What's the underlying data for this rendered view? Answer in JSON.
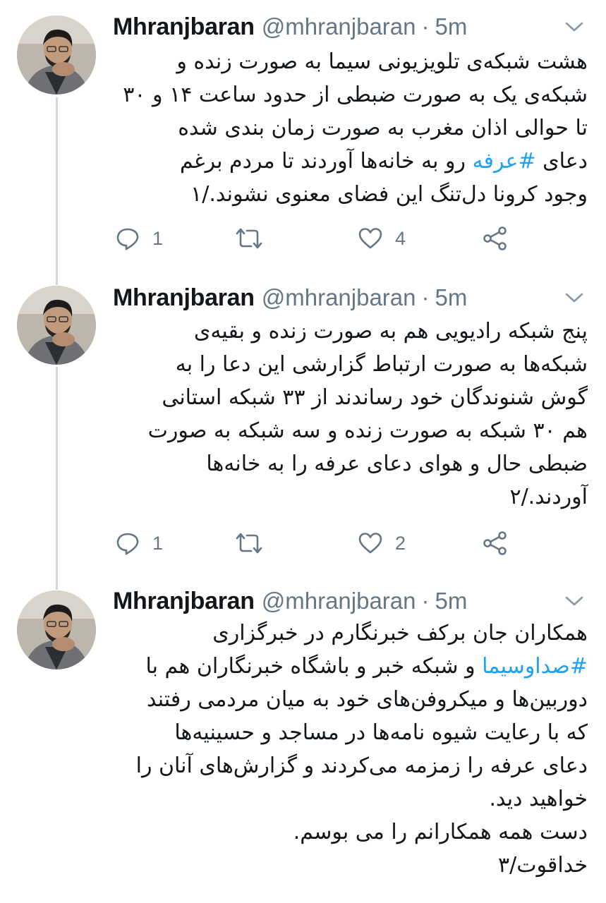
{
  "tweets": [
    {
      "name": "Mhranjbaran",
      "handle": "@mhranjbaran",
      "dot": "·",
      "time": "5m",
      "lines": [
        {
          "text": "هشت شبکه‌ی تلویزیونی سیما به صورت زنده و"
        },
        {
          "text": "شبکه‌ی یک به صورت ضبطی از حدود ساعت ۱۴ و ۳۰"
        },
        {
          "text": "تا حوالی اذان مغرب به صورت زمان بندی شده"
        },
        {
          "pre": "دعای ",
          "tag": "#عرفه",
          "post": " رو به خانه‌ها آوردند تا مردم برغم"
        },
        {
          "text": "وجود کرونا دل‌تنگ این فضای معنوی نشوند./۱"
        }
      ],
      "reply_count": "1",
      "like_count": "4"
    },
    {
      "name": "Mhranjbaran",
      "handle": "@mhranjbaran",
      "dot": "·",
      "time": "5m",
      "lines": [
        {
          "text": "پنج شبکه رادیویی هم به صورت زنده و بقیه‌ی"
        },
        {
          "text": "شبکه‌ها به صورت ارتباط گزارشی این دعا را به"
        },
        {
          "text": "گوش شنوندگان خود رساندند از ۳۳ شبکه استانی"
        },
        {
          "text": "هم ۳۰ شبکه به صورت زنده و سه شبکه به صورت"
        },
        {
          "text": "ضبطی حال و هوای دعای عرفه را به خانه‌ها"
        },
        {
          "text": "آوردند./۲"
        }
      ],
      "reply_count": "1",
      "like_count": "2"
    },
    {
      "name": "Mhranjbaran",
      "handle": "@mhranjbaran",
      "dot": "·",
      "time": "5m",
      "lines": [
        {
          "text": "همکاران جان برکف خبرنگارم در خبرگزاری"
        },
        {
          "pre": "",
          "tag": "#صداوسیما",
          "post": " و شبکه خبر و باشگاه خبرنگاران هم با"
        },
        {
          "text": "دوربین‌ها و میکروفن‌های خود به میان مردمی رفتند"
        },
        {
          "text": "که با رعایت شیوه نامه‌ها در مساجد و حسینیه‌ها"
        },
        {
          "text": "دعای عرفه را زمزمه می‌کردند و گزارش‌های آنان را"
        },
        {
          "text": "خواهید دید."
        },
        {
          "text": "دست همه همکارانم را می بوسم."
        },
        {
          "text": "خداقوت/۳"
        }
      ]
    }
  ],
  "colors": {
    "text": "#14171a",
    "secondary": "#657786",
    "hashtag": "#1da1f2",
    "thread_line": "#cfd9de"
  },
  "icons": [
    "reply-icon",
    "retweet-icon",
    "like-icon",
    "share-icon",
    "chevron-down-icon",
    "avatar"
  ]
}
